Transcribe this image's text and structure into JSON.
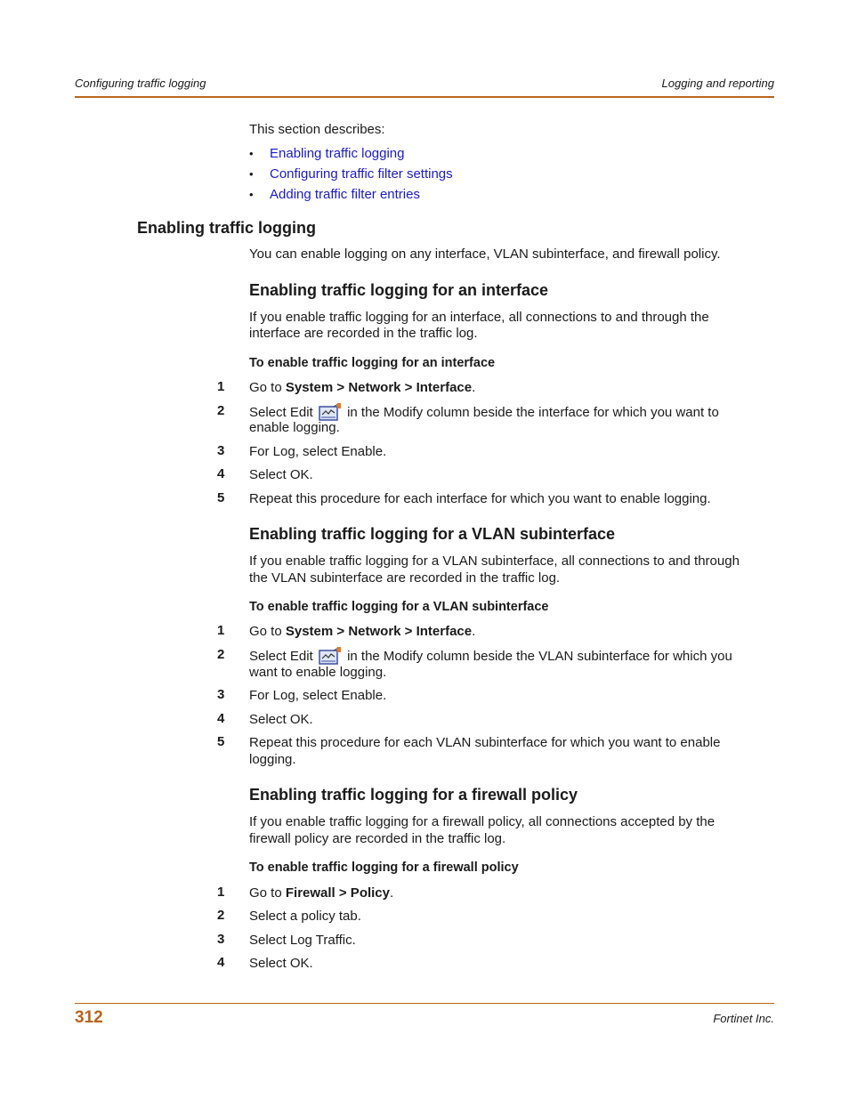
{
  "header": {
    "left": "Configuring traffic logging",
    "right": "Logging and reporting"
  },
  "intro": {
    "text": "This section describes:",
    "links": [
      "Enabling traffic logging",
      "Configuring traffic filter settings",
      "Adding traffic filter entries"
    ]
  },
  "section": {
    "title": "Enabling traffic logging",
    "text": "You can enable logging on any interface, VLAN subinterface, and firewall policy."
  },
  "interface": {
    "title": "Enabling traffic logging for an interface",
    "text_line1": "If you enable traffic logging for an interface, all connections to and through the",
    "text_line2": "interface are recorded in the traffic log.",
    "procedure": "To enable traffic logging for an interface",
    "steps": [
      {
        "num": "1",
        "pre": "Go to ",
        "bold": "System > Network > Interface",
        "post": "."
      },
      {
        "num": "2",
        "pre": "Select Edit",
        "post_line1": "in the Modify column beside the interface for which you want to",
        "line2": "enable logging."
      },
      {
        "num": "3",
        "text": "For Log, select Enable."
      },
      {
        "num": "4",
        "text": "Select OK."
      },
      {
        "num": "5",
        "text": "Repeat this procedure for each interface for which you want to enable logging."
      }
    ]
  },
  "vlan": {
    "title": "Enabling traffic logging for a VLAN subinterface",
    "text_line1": "If you enable traffic logging for a VLAN subinterface, all connections to and through",
    "text_line2": "the VLAN subinterface are recorded in the traffic log.",
    "procedure": "To enable traffic logging for a VLAN subinterface",
    "steps": [
      {
        "num": "1",
        "pre": "Go to ",
        "bold": "System > Network > Interface",
        "post": "."
      },
      {
        "num": "2",
        "pre": "Select Edit",
        "post_line1": "in the Modify column beside the VLAN subinterface for which you",
        "line2": "want to enable logging."
      },
      {
        "num": "3",
        "text": "For Log, select Enable."
      },
      {
        "num": "4",
        "text": "Select OK."
      },
      {
        "num": "5",
        "text_line1": "Repeat this procedure for each VLAN subinterface for which you want to enable",
        "text_line2": "logging."
      }
    ]
  },
  "firewall": {
    "title": "Enabling traffic logging for a firewall policy",
    "text_line1": "If you enable traffic logging for a firewall policy, all connections accepted by the",
    "text_line2": "firewall policy are recorded in the traffic log.",
    "procedure": "To enable traffic logging for a firewall policy",
    "steps": [
      {
        "num": "1",
        "pre": "Go to ",
        "bold": "Firewall > Policy",
        "post": "."
      },
      {
        "num": "2",
        "text": "Select a policy tab."
      },
      {
        "num": "3",
        "text": "Select Log Traffic."
      },
      {
        "num": "4",
        "text": "Select OK."
      }
    ]
  },
  "footer": {
    "page_number": "312",
    "company": "Fortinet Inc."
  },
  "colors": {
    "accent": "#b8651c",
    "link": "#1a1acc"
  }
}
